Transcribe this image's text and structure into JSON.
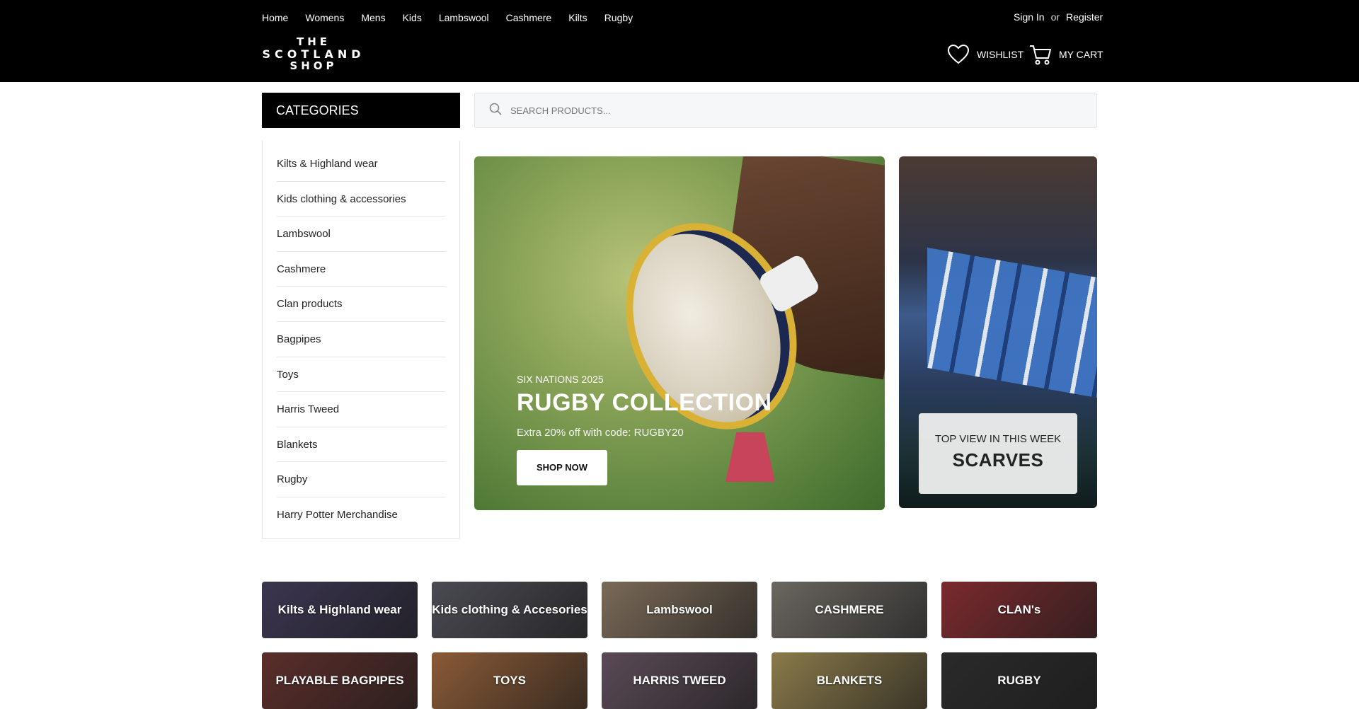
{
  "nav": {
    "links": [
      "Home",
      "Womens",
      "Mens",
      "Kids",
      "Lambswool",
      "Cashmere",
      "Kilts",
      "Rugby"
    ],
    "sign_in": "Sign In",
    "or": "or",
    "register": "Register"
  },
  "logo": {
    "line1": "THE",
    "line2": "SCOTLAND",
    "line3": "SHOP"
  },
  "header": {
    "wishlist": "WISHLIST",
    "cart": "MY CART"
  },
  "categories": {
    "title": "CATEGORIES",
    "items": [
      "Kilts & Highland wear",
      "Kids clothing & accessories",
      "Lambswool",
      "Cashmere",
      "Clan products",
      "Bagpipes",
      "Toys",
      "Harris Tweed",
      "Blankets",
      "Rugby",
      "Harry Potter Merchandise"
    ]
  },
  "search": {
    "placeholder": "SEARCH PRODUCTS..."
  },
  "hero": {
    "kicker": "SIX NATIONS 2025",
    "title": "RUGBY COLLECTION",
    "subtitle": "Extra 20% off with code: RUGBY20",
    "button": "SHOP NOW"
  },
  "promo": {
    "kicker": "TOP VIEW IN THIS WEEK",
    "title": "SCARVES"
  },
  "tiles": [
    {
      "label": "Kilts & Highland wear",
      "color": "#3b3550"
    },
    {
      "label": "Kids clothing & Accesories",
      "color": "#4a4a52"
    },
    {
      "label": "Lambswool",
      "color": "#7a6a58"
    },
    {
      "label": "CASHMERE",
      "color": "#6a6660"
    },
    {
      "label": "CLAN's",
      "color": "#7a2a2e"
    },
    {
      "label": "PLAYABLE BAGPIPES",
      "color": "#5a2e2a"
    },
    {
      "label": "TOYS",
      "color": "#8a5a36"
    },
    {
      "label": "HARRIS TWEED",
      "color": "#5a4a56"
    },
    {
      "label": "BLANKETS",
      "color": "#8a7a4a"
    },
    {
      "label": "RUGBY",
      "color": "#2a2a2a"
    }
  ]
}
